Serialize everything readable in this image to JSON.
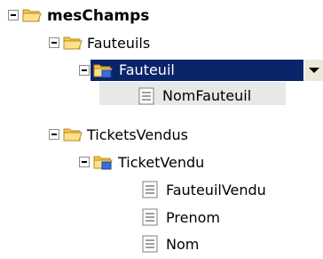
{
  "tree": {
    "root": {
      "label": "mesChamps"
    },
    "fauteuils": {
      "label": "Fauteuils"
    },
    "fauteuil": {
      "label": "Fauteuil"
    },
    "nom_fauteuil": {
      "label": "NomFauteuil"
    },
    "tickets_vendus": {
      "label": "TicketsVendus"
    },
    "ticket_vendu": {
      "label": "TicketVendu"
    },
    "fauteuil_vendu": {
      "label": "FauteuilVendu"
    },
    "prenom": {
      "label": "Prenom"
    },
    "nom": {
      "label": "Nom"
    }
  },
  "colors": {
    "selection": "#0a246a",
    "folder": "#f5c342",
    "field_row_bg": "#e8e8e8"
  },
  "icons": {
    "folder": "folder-icon",
    "repeating_group": "repeating-group-folder-icon",
    "field": "field-icon"
  }
}
